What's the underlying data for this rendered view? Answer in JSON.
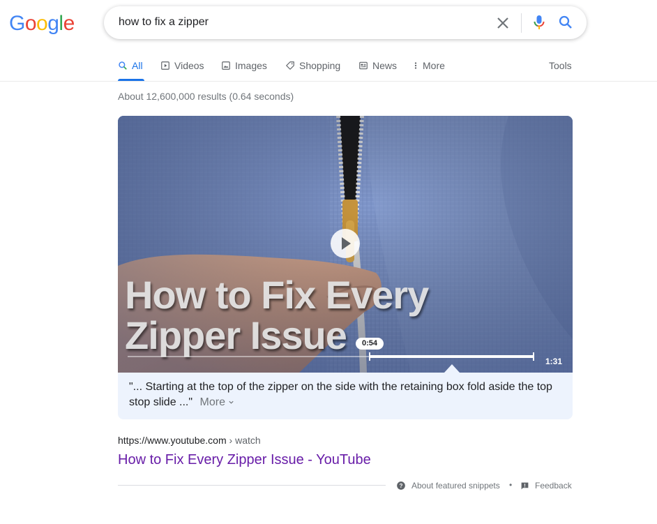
{
  "logo": {
    "letters": [
      "G",
      "o",
      "o",
      "g",
      "l",
      "e"
    ],
    "colors": [
      "#4285f4",
      "#ea4335",
      "#fbbc05",
      "#4285f4",
      "#34a853",
      "#ea4335"
    ]
  },
  "search": {
    "query": "how to fix a zipper"
  },
  "tabs": [
    {
      "label": "All",
      "icon": "search-icon",
      "active": true
    },
    {
      "label": "Videos",
      "icon": "play-box-icon"
    },
    {
      "label": "Images",
      "icon": "image-icon"
    },
    {
      "label": "Shopping",
      "icon": "tag-icon"
    },
    {
      "label": "News",
      "icon": "newspaper-icon"
    },
    {
      "label": "More",
      "icon": "kebab-icon"
    }
  ],
  "tools_label": "Tools",
  "result_stats": "About 12,600,000 results (0.64 seconds)",
  "video": {
    "overlay_title_line1": "How to Fix Every",
    "overlay_title_line2": "Zipper Issue",
    "current_time": "0:54",
    "duration": "1:31",
    "progress_fraction": 0.593
  },
  "snippet": {
    "text": "\"... Starting at the top of the zipper on the side with the retaining box fold aside the top stop slide ...\"",
    "more_label": "More"
  },
  "result": {
    "url": "https://www.youtube.com",
    "crumb": " › watch",
    "title": "How to Fix Every Zipper Issue - YouTube"
  },
  "footer": {
    "about_label": "About featured snippets",
    "separator": "•",
    "feedback_label": "Feedback"
  },
  "colors": {
    "accent": "#1a73e8",
    "visited_link": "#681da8",
    "snippet_bg": "#edf3fd"
  }
}
